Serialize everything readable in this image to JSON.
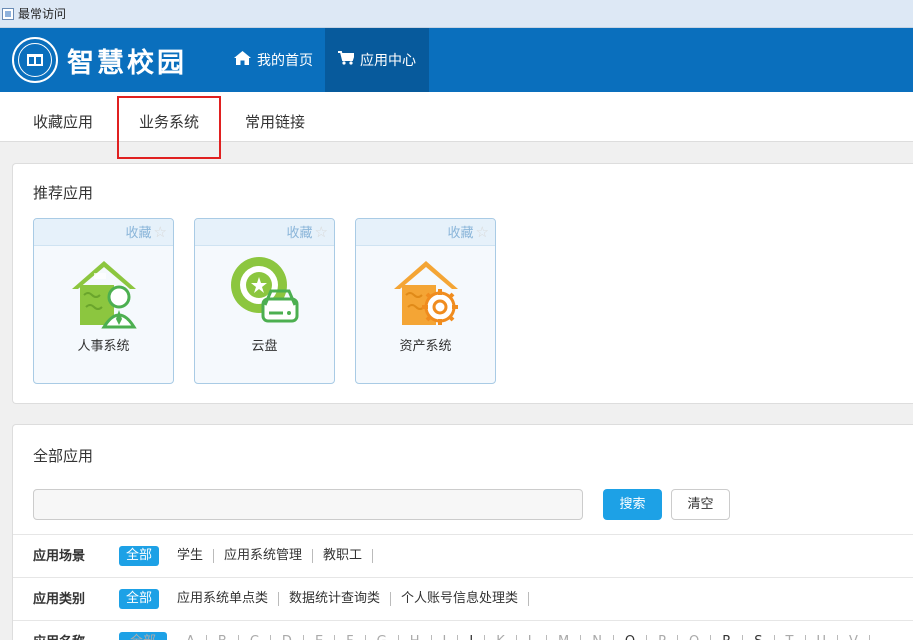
{
  "bookmarks": {
    "label": "最常访问",
    "icon": "folder-icon"
  },
  "header": {
    "logo_icon": "campus-seal-icon",
    "title": "智慧校园",
    "nav": [
      {
        "label": "我的首页",
        "icon": "home-icon"
      },
      {
        "label": "应用中心",
        "icon": "cart-icon"
      }
    ]
  },
  "tabs": [
    "收藏应用",
    "业务系统",
    "常用链接"
  ],
  "recommended": {
    "title": "推荐应用",
    "favorite_label": "收藏",
    "apps": [
      {
        "name": "人事系统",
        "icon": "hr-system-icon"
      },
      {
        "name": "云盘",
        "icon": "cloud-drive-icon"
      },
      {
        "name": "资产系统",
        "icon": "asset-system-icon"
      }
    ]
  },
  "all_apps": {
    "title": "全部应用",
    "search_button": "搜索",
    "clear_button": "清空",
    "filters": [
      {
        "label": "应用场景",
        "options": [
          "全部",
          "学生",
          "应用系统管理",
          "教职工"
        ]
      },
      {
        "label": "应用类别",
        "options": [
          "全部",
          "应用系统单点类",
          "数据统计查询类",
          "个人账号信息处理类"
        ]
      },
      {
        "label": "应用名称",
        "options": [
          "全部",
          "A",
          "B",
          "C",
          "D",
          "E",
          "F",
          "G",
          "H",
          "I",
          "J",
          "K",
          "L",
          "M",
          "N",
          "O",
          "P",
          "Q",
          "R",
          "S",
          "T",
          "U",
          "V"
        ]
      }
    ]
  },
  "colors": {
    "header_bg": "#0a6fbd",
    "nav_active_bg": "#075a9c",
    "accent": "#1da1e6",
    "highlight": "#e02020"
  }
}
